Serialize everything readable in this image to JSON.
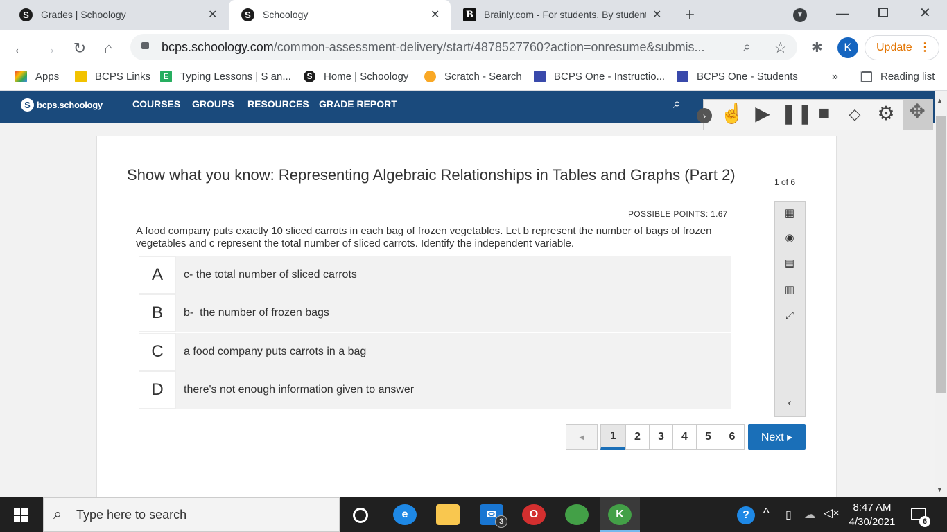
{
  "browser": {
    "tabs": [
      {
        "title": "Grades | Schoology",
        "icon": "S"
      },
      {
        "title": "Schoology",
        "icon": "S"
      },
      {
        "title": "Brainly.com - For students. By students",
        "icon": "B"
      }
    ],
    "url_domain": "bcps.schoology.com",
    "url_path": "/common-assessment-delivery/start/4878527760?action=onresume&submis...",
    "profile_initial": "K",
    "update_label": "Update",
    "bookmarks": [
      "Apps",
      "BCPS Links",
      "Typing Lessons | S an...",
      "Home | Schoology",
      "Scratch - Search",
      "BCPS One - Instructio...",
      "BCPS One - Students"
    ],
    "reading_list": "Reading list",
    "more": "»"
  },
  "schoology": {
    "logo": "bcps.schoology",
    "nav": [
      "COURSES",
      "GROUPS",
      "RESOURCES",
      "GRADE REPORT"
    ]
  },
  "assessment": {
    "title": "Show what you know: Representing Algebraic Relationships in Tables and Graphs (Part 2)",
    "page_count": "1 of 6",
    "points": "POSSIBLE POINTS: 1.67",
    "question": "A food company puts exactly 10 sliced carrots in each bag of frozen vegetables.  Let b represent the number of bags of frozen vegetables and c represent the total number of sliced carrots.  Identify the independent variable.",
    "choices": [
      {
        "letter": "A",
        "text": "c- the total number of sliced carrots"
      },
      {
        "letter": "B",
        "text": "b-  the number of frozen bags"
      },
      {
        "letter": "C",
        "text": "a food company puts carrots in a bag"
      },
      {
        "letter": "D",
        "text": "there's not enough information given to answer"
      }
    ],
    "pages": [
      "1",
      "2",
      "3",
      "4",
      "5",
      "6"
    ],
    "prev": "◂",
    "next": "Next ▸"
  },
  "taskbar": {
    "search_placeholder": "Type here to search",
    "time": "8:47 AM",
    "date": "4/30/2021",
    "mail_badge": "3",
    "notif_badge": "6"
  },
  "colors": {
    "schoology_nav": "#1a4a7c",
    "next_button": "#1a6fb8",
    "update": "#e37400"
  }
}
